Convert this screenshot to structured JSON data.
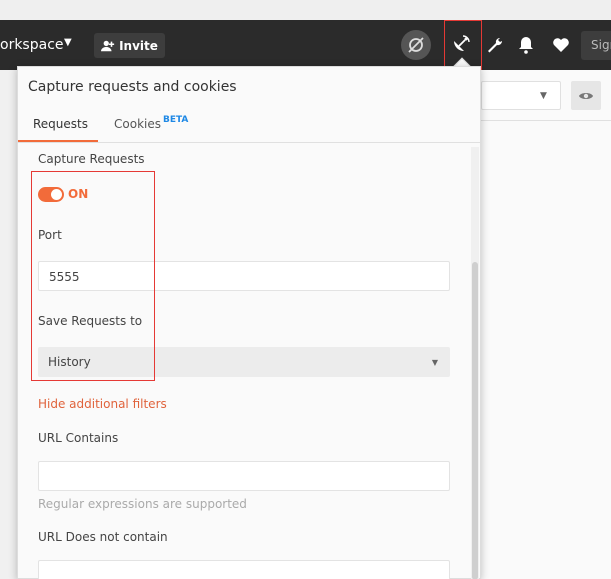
{
  "header": {
    "workspace_label": "orkspace",
    "invite_label": "Invite",
    "signin_label": "Sign"
  },
  "icons": {
    "sync": "sync-off-icon",
    "capture": "satellite-dish-icon",
    "settings": "wrench-icon",
    "notifications": "bell-icon",
    "favorites": "heart-icon",
    "visibility": "eye-icon"
  },
  "colors": {
    "accent": "#f26b3a",
    "highlight": "#e53935",
    "beta": "#1e88e5"
  },
  "panel": {
    "title": "Capture requests and cookies",
    "tabs": [
      {
        "label": "Requests",
        "active": true
      },
      {
        "label": "Cookies",
        "badge": "BETA",
        "active": false
      }
    ],
    "capture_requests_label": "Capture Requests",
    "toggle_state": "ON",
    "port_label": "Port",
    "port_value": "5555",
    "save_to_label": "Save Requests to",
    "save_to_value": "History",
    "hide_filters_link": "Hide additional filters",
    "url_contains_label": "URL Contains",
    "url_contains_value": "",
    "regex_hint": "Regular expressions are supported",
    "url_not_contain_label": "URL Does not contain",
    "url_not_contain_value": ""
  }
}
